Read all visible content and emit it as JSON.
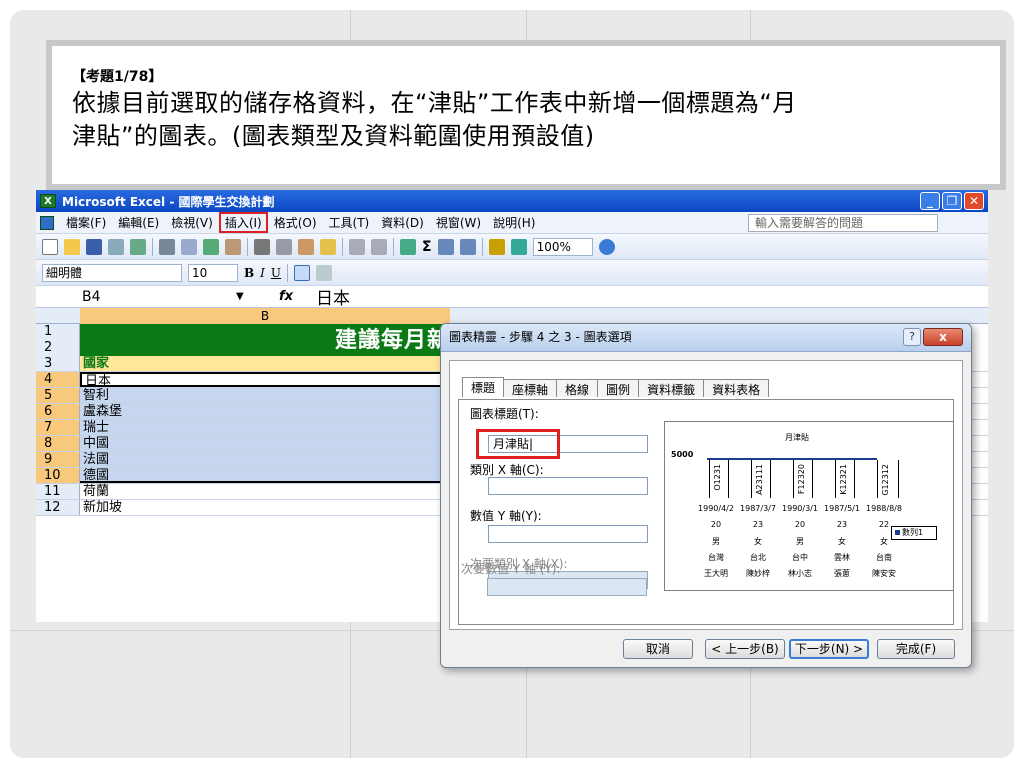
{
  "question": {
    "label": "【考題1/78】",
    "text_line1": "依據目前選取的儲存格資料，在“津貼”工作表中新增一個標題為“月",
    "text_line2": "津貼”的圖表。(圖表類型及資料範圍使用預設值)"
  },
  "excel": {
    "title": "Microsoft Excel - 國際學生交換計劃",
    "menu": [
      "檔案(F)",
      "編輯(E)",
      "檢視(V)",
      "插入(I)",
      "格式(O)",
      "工具(T)",
      "資料(D)",
      "視窗(W)",
      "說明(H)"
    ],
    "help_placeholder": "輸入需要解答的問題",
    "zoom": "100%",
    "font_name": "細明體",
    "font_size": "10",
    "name_box": "B4",
    "fx_label": "fx",
    "formula_value": "日本",
    "col_b": "B",
    "banner": "建議每月新",
    "rows": [
      {
        "n": "1",
        "v": ""
      },
      {
        "n": "2",
        "v": ""
      },
      {
        "n": "3",
        "v": "國家"
      },
      {
        "n": "4",
        "v": "日本"
      },
      {
        "n": "5",
        "v": "智利"
      },
      {
        "n": "6",
        "v": "盧森堡"
      },
      {
        "n": "7",
        "v": "瑞士"
      },
      {
        "n": "8",
        "v": "中國"
      },
      {
        "n": "9",
        "v": "法國"
      },
      {
        "n": "10",
        "v": "德國"
      },
      {
        "n": "11",
        "v": "荷蘭"
      },
      {
        "n": "12",
        "v": "新加坡"
      }
    ]
  },
  "dialog": {
    "title": "圖表精靈 - 步驟 4 之 3 - 圖表選項",
    "help": "?",
    "close": "x",
    "tabs": [
      "標題",
      "座標軸",
      "格線",
      "圖例",
      "資料標籤",
      "資料表格"
    ],
    "chart_title_label": "圖表標題(T):",
    "chart_title_value": "月津貼|",
    "x_axis_label": "類別 X 軸(C):",
    "y_axis_label": "數值 Y 軸(Y):",
    "x2_axis_label": "次要類別 X 軸(X):",
    "y2_axis_label": "次要數值 Y 軸 (Y):",
    "preview": {
      "title": "月津貼",
      "axis_value": "5000",
      "ids": [
        "O1231",
        "A23111",
        "F12320",
        "K12321",
        "G12312"
      ],
      "dates": [
        "1990/4/2",
        "1987/3/7",
        "1990/3/1",
        "1987/5/1",
        "1988/8/8"
      ],
      "ages": [
        "20",
        "23",
        "20",
        "23",
        "22"
      ],
      "genders": [
        "男",
        "女",
        "男",
        "女",
        "女"
      ],
      "cities": [
        "台灣",
        "台北",
        "台中",
        "雲林",
        "台南"
      ],
      "names": [
        "王大明",
        "陳妙梓",
        "林小志",
        "張蔥",
        "陳安安"
      ],
      "legend": "數列1"
    },
    "buttons": {
      "cancel": "取消",
      "back": "< 上一步(B)",
      "next": "下一步(N) >",
      "finish": "完成(F)"
    }
  }
}
